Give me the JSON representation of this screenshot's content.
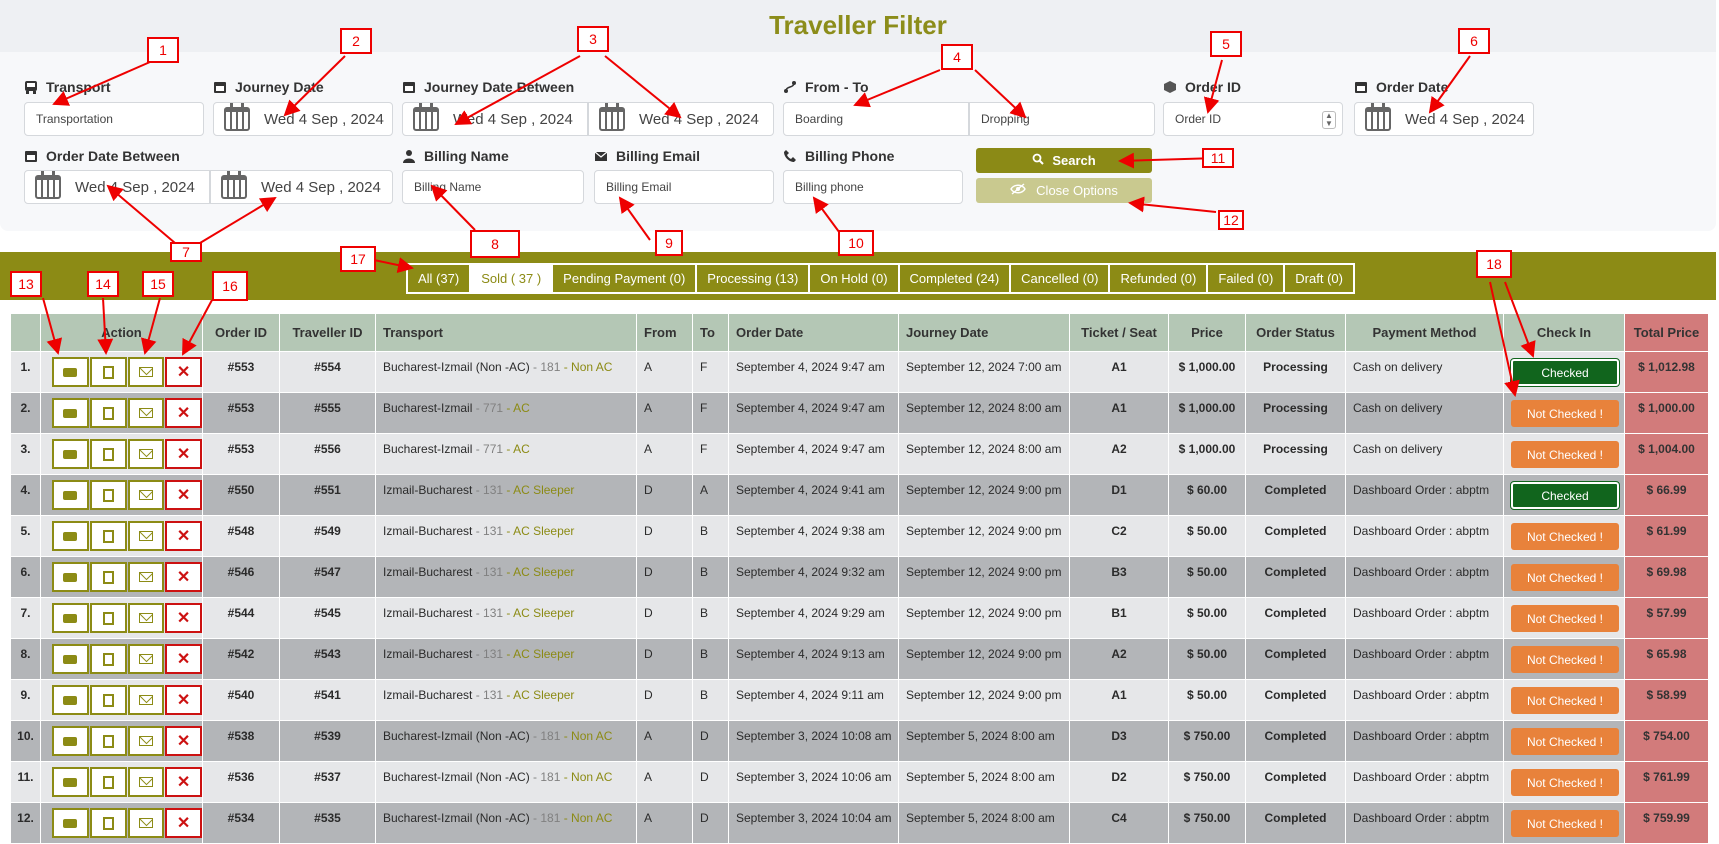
{
  "title": "Traveller Filter",
  "filters": {
    "transport": {
      "label": "Transport",
      "placeholder": "Transportation"
    },
    "journey_date": {
      "label": "Journey Date",
      "value": "Wed 4 Sep , 2024"
    },
    "journey_between": {
      "label": "Journey Date Between",
      "from": "Wed 4 Sep , 2024",
      "to": "Wed 4 Sep , 2024"
    },
    "from_to": {
      "label": "From - To",
      "boarding": "Boarding",
      "dropping": "Dropping"
    },
    "order_id": {
      "label": "Order ID",
      "placeholder": "Order ID"
    },
    "order_date": {
      "label": "Order Date",
      "value": "Wed 4 Sep , 2024"
    },
    "order_between": {
      "label": "Order Date Between",
      "from": "Wed 4 Sep , 2024",
      "to": "Wed 4 Sep , 2024"
    },
    "billing_name": {
      "label": "Billing Name",
      "placeholder": "Billing Name"
    },
    "billing_email": {
      "label": "Billing Email",
      "placeholder": "Billing Email"
    },
    "billing_phone": {
      "label": "Billing Phone",
      "placeholder": "Billing phone"
    },
    "search_label": "Search",
    "close_label": "Close Options"
  },
  "tabs": [
    {
      "label": "All (37)",
      "active": false
    },
    {
      "label": "Sold ( 37 )",
      "active": true
    },
    {
      "label": "Pending Payment (0)",
      "active": false
    },
    {
      "label": "Processing (13)",
      "active": false
    },
    {
      "label": "On Hold (0)",
      "active": false
    },
    {
      "label": "Completed (24)",
      "active": false
    },
    {
      "label": "Cancelled (0)",
      "active": false
    },
    {
      "label": "Refunded (0)",
      "active": false
    },
    {
      "label": "Failed (0)",
      "active": false
    },
    {
      "label": "Draft (0)",
      "active": false
    }
  ],
  "columns": [
    "",
    "Action",
    "Order ID",
    "Traveller ID",
    "Transport",
    "From",
    "To",
    "Order Date",
    "Journey Date",
    "Ticket / Seat",
    "Price",
    "Order Status",
    "Payment Method",
    "Check In",
    "Total Price"
  ],
  "rows": [
    {
      "n": "1.",
      "order": "#553",
      "trav": "#554",
      "route": "Bucharest-Izmail (Non -AC)",
      "num": " - 181",
      "type": " - Non AC",
      "from": "A",
      "to": "F",
      "odate": "September 4, 2024 9:47 am",
      "jdate": "September 12, 2024 7:00 am",
      "seat": "A1",
      "price": "$ 1,000.00",
      "status": "Processing",
      "pay": "Cash on delivery",
      "checkin": "Checked",
      "checked": true,
      "total": "$ 1,012.98"
    },
    {
      "n": "2.",
      "order": "#553",
      "trav": "#555",
      "route": "Bucharest-Izmail",
      "num": " - 771",
      "type": " - AC",
      "from": "A",
      "to": "F",
      "odate": "September 4, 2024 9:47 am",
      "jdate": "September 12, 2024 8:00 am",
      "seat": "A1",
      "price": "$ 1,000.00",
      "status": "Processing",
      "pay": "Cash on delivery",
      "checkin": "Not Checked !",
      "checked": false,
      "total": "$ 1,000.00"
    },
    {
      "n": "3.",
      "order": "#553",
      "trav": "#556",
      "route": "Bucharest-Izmail",
      "num": " - 771",
      "type": " - AC",
      "from": "A",
      "to": "F",
      "odate": "September 4, 2024 9:47 am",
      "jdate": "September 12, 2024 8:00 am",
      "seat": "A2",
      "price": "$ 1,000.00",
      "status": "Processing",
      "pay": "Cash on delivery",
      "checkin": "Not Checked !",
      "checked": false,
      "total": "$ 1,004.00"
    },
    {
      "n": "4.",
      "order": "#550",
      "trav": "#551",
      "route": "Izmail-Bucharest",
      "num": " - 131",
      "type": " - AC Sleeper",
      "from": "D",
      "to": "A",
      "odate": "September 4, 2024 9:41 am",
      "jdate": "September 12, 2024 9:00 pm",
      "seat": "D1",
      "price": "$ 60.00",
      "status": "Completed",
      "pay": "Dashboard Order : abptm",
      "checkin": "Checked",
      "checked": true,
      "total": "$ 66.99"
    },
    {
      "n": "5.",
      "order": "#548",
      "trav": "#549",
      "route": "Izmail-Bucharest",
      "num": " - 131",
      "type": " - AC Sleeper",
      "from": "D",
      "to": "B",
      "odate": "September 4, 2024 9:38 am",
      "jdate": "September 12, 2024 9:00 pm",
      "seat": "C2",
      "price": "$ 50.00",
      "status": "Completed",
      "pay": "Dashboard Order : abptm",
      "checkin": "Not Checked !",
      "checked": false,
      "total": "$ 61.99"
    },
    {
      "n": "6.",
      "order": "#546",
      "trav": "#547",
      "route": "Izmail-Bucharest",
      "num": " - 131",
      "type": " - AC Sleeper",
      "from": "D",
      "to": "B",
      "odate": "September 4, 2024 9:32 am",
      "jdate": "September 12, 2024 9:00 pm",
      "seat": "B3",
      "price": "$ 50.00",
      "status": "Completed",
      "pay": "Dashboard Order : abptm",
      "checkin": "Not Checked !",
      "checked": false,
      "total": "$ 69.98"
    },
    {
      "n": "7.",
      "order": "#544",
      "trav": "#545",
      "route": "Izmail-Bucharest",
      "num": " - 131",
      "type": " - AC Sleeper",
      "from": "D",
      "to": "B",
      "odate": "September 4, 2024 9:29 am",
      "jdate": "September 12, 2024 9:00 pm",
      "seat": "B1",
      "price": "$ 50.00",
      "status": "Completed",
      "pay": "Dashboard Order : abptm",
      "checkin": "Not Checked !",
      "checked": false,
      "total": "$ 57.99"
    },
    {
      "n": "8.",
      "order": "#542",
      "trav": "#543",
      "route": "Izmail-Bucharest",
      "num": " - 131",
      "type": " - AC Sleeper",
      "from": "D",
      "to": "B",
      "odate": "September 4, 2024 9:13 am",
      "jdate": "September 12, 2024 9:00 pm",
      "seat": "A2",
      "price": "$ 50.00",
      "status": "Completed",
      "pay": "Dashboard Order : abptm",
      "checkin": "Not Checked !",
      "checked": false,
      "total": "$ 65.98"
    },
    {
      "n": "9.",
      "order": "#540",
      "trav": "#541",
      "route": "Izmail-Bucharest",
      "num": " - 131",
      "type": " - AC Sleeper",
      "from": "D",
      "to": "B",
      "odate": "September 4, 2024 9:11 am",
      "jdate": "September 12, 2024 9:00 pm",
      "seat": "A1",
      "price": "$ 50.00",
      "status": "Completed",
      "pay": "Dashboard Order : abptm",
      "checkin": "Not Checked !",
      "checked": false,
      "total": "$ 58.99"
    },
    {
      "n": "10.",
      "order": "#538",
      "trav": "#539",
      "route": "Bucharest-Izmail (Non -AC)",
      "num": " - 181",
      "type": " - Non AC",
      "from": "A",
      "to": "D",
      "odate": "September 3, 2024 10:08 am",
      "jdate": "September 5, 2024 8:00 am",
      "seat": "D3",
      "price": "$ 750.00",
      "status": "Completed",
      "pay": "Dashboard Order : abptm",
      "checkin": "Not Checked !",
      "checked": false,
      "total": "$ 754.00"
    },
    {
      "n": "11.",
      "order": "#536",
      "trav": "#537",
      "route": "Bucharest-Izmail (Non -AC)",
      "num": " - 181",
      "type": " - Non AC",
      "from": "A",
      "to": "D",
      "odate": "September 3, 2024 10:06 am",
      "jdate": "September 5, 2024 8:00 am",
      "seat": "D2",
      "price": "$ 750.00",
      "status": "Completed",
      "pay": "Dashboard Order : abptm",
      "checkin": "Not Checked !",
      "checked": false,
      "total": "$ 761.99"
    },
    {
      "n": "12.",
      "order": "#534",
      "trav": "#535",
      "route": "Bucharest-Izmail (Non -AC)",
      "num": " - 181",
      "type": " - Non AC",
      "from": "A",
      "to": "D",
      "odate": "September 3, 2024 10:04 am",
      "jdate": "September 5, 2024 8:00 am",
      "seat": "C4",
      "price": "$ 750.00",
      "status": "Completed",
      "pay": "Dashboard Order : abptm",
      "checkin": "Not Checked !",
      "checked": false,
      "total": "$ 759.99"
    }
  ],
  "annotations": [
    "1",
    "2",
    "3",
    "4",
    "5",
    "6",
    "7",
    "8",
    "9",
    "10",
    "11",
    "12",
    "13",
    "14",
    "15",
    "16",
    "17",
    "18"
  ],
  "colors": {
    "accent": "#8c8b15",
    "checked": "#11651d",
    "not_checked": "#e8823b",
    "total_bg": "#d27b7b",
    "annotation": "#ee0000"
  }
}
